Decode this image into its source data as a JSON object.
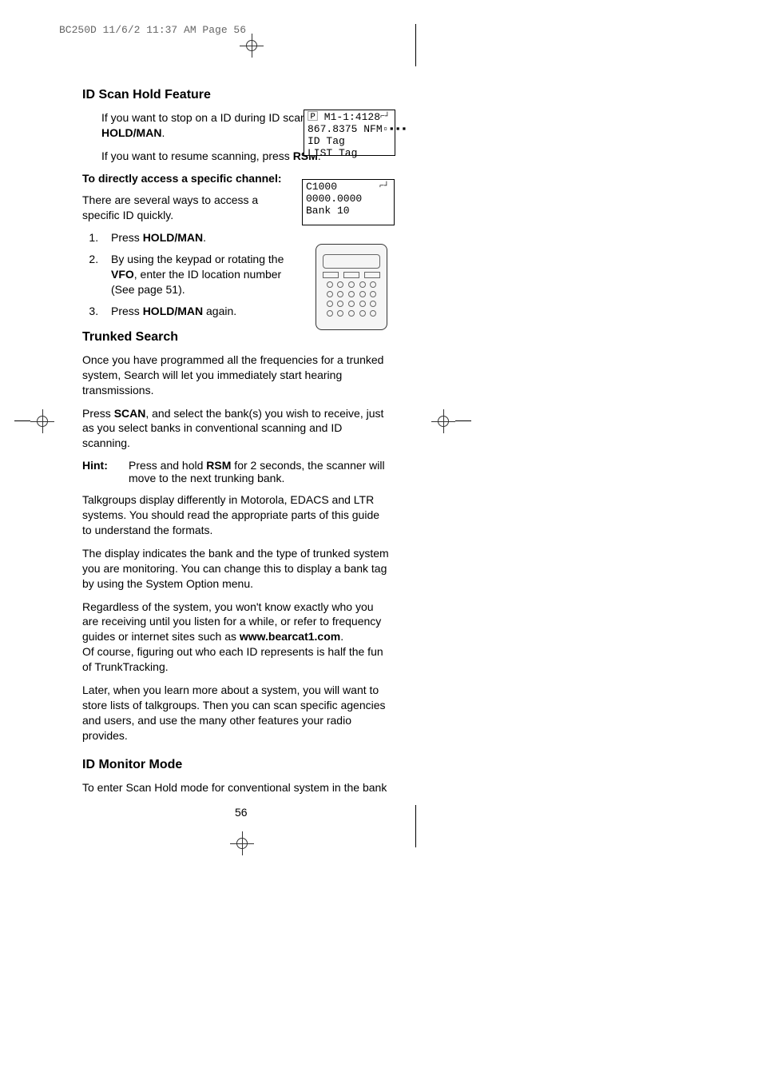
{
  "header": {
    "print_mark": "BC250D  11/6/2  11:37 AM  Page 56"
  },
  "sections": {
    "id_scan_hold": {
      "title": "ID Scan Hold Feature",
      "p1_pre": "If you want to stop on a ID during ID scanning, press ",
      "p1_bold": "HOLD/MAN",
      "p1_post": ".",
      "p2_pre": "If you want to resume scanning, press ",
      "p2_bold": "RSM",
      "p2_post": ".",
      "bold_line": "To directly access a specific channel:",
      "p3": "There are several ways to access a specific ID quickly.",
      "steps": {
        "s1_pre": "Press ",
        "s1_bold": "HOLD/MAN",
        "s1_post": ".",
        "s2_pre": "By using the keypad or rotating the ",
        "s2_bold": "VFO",
        "s2_post": ", enter the ID location number (See page 51).",
        "s3_pre": "Press ",
        "s3_bold": "HOLD/MAN",
        "s3_post": " again."
      }
    },
    "trunked_search": {
      "title": "Trunked Search",
      "p1": "Once you have programmed all the frequencies for a trunked system, Search will let you immediately start hearing transmissions.",
      "p2_pre": "Press ",
      "p2_bold": "SCAN",
      "p2_post": ", and select the bank(s) you wish to receive, just as you select banks in conventional scanning and ID scanning.",
      "hint_label": "Hint:",
      "hint_pre": "Press and hold ",
      "hint_bold": "RSM",
      "hint_post": " for 2 seconds, the scanner will move to the next trunking bank.",
      "p3": "Talkgroups display differently in Motorola, EDACS and LTR systems. You should read the appropriate parts of this guide to understand the formats.",
      "p4": "The display indicates the bank and the type of trunked system you are monitoring. You can change this to display a bank tag by using the System Option menu.",
      "p5_pre": "Regardless of the system, you won't know exactly who you are receiving until you listen for a while, or refer to frequency guides or internet sites such as ",
      "p5_bold": "www.bearcat1.com",
      "p5_post": ".",
      "p5b": "Of course, figuring out who each ID represents is half the fun of TrunkTracking.",
      "p6": "Later, when you learn more about a system, you will want to store lists of talkgroups. Then you can scan specific agencies and users, and use the many other features your radio provides."
    },
    "id_monitor": {
      "title": "ID Monitor Mode",
      "p1": "To enter Scan Hold mode for conventional system in the bank"
    }
  },
  "lcd1": {
    "line1": "🄿 M1-1:4128",
    "line2": " 867.8375 NFM▫▪▪▪",
    "line3": "ID Tag",
    "line4": "LIST Tag"
  },
  "lcd2": {
    "line1": "          C1000",
    "line2": "0000.0000",
    "line3": " ",
    "line4": "Bank 10"
  },
  "page_number": "56"
}
